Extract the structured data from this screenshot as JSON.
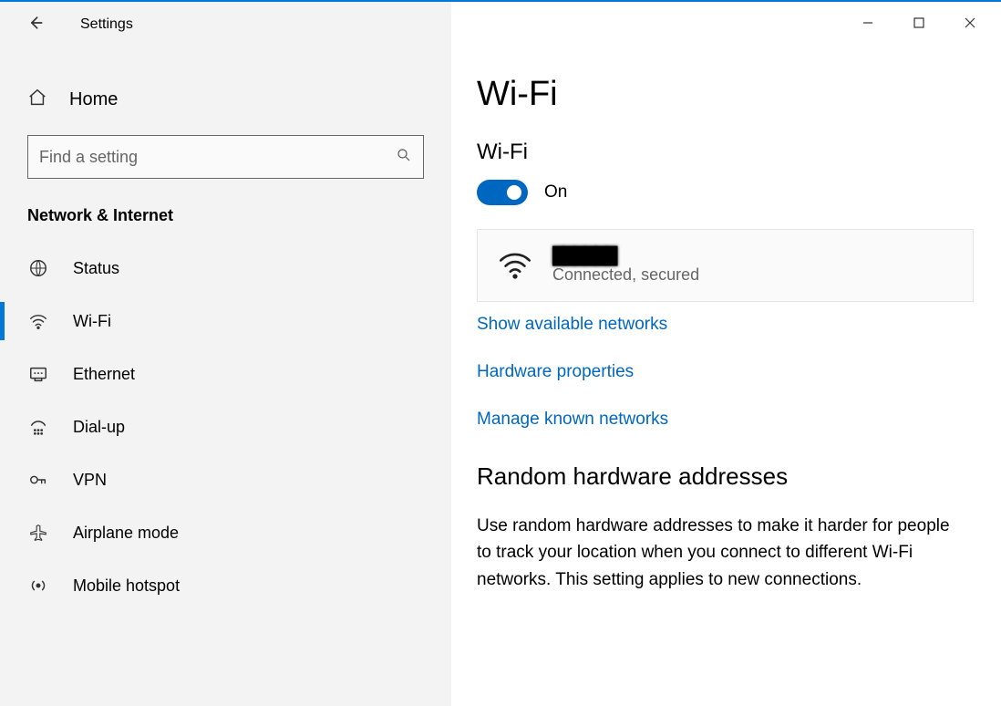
{
  "app_title": "Settings",
  "sidebar": {
    "home_label": "Home",
    "search_placeholder": "Find a setting",
    "category_heading": "Network & Internet",
    "items": [
      {
        "key": "status",
        "label": "Status",
        "active": false
      },
      {
        "key": "wifi",
        "label": "Wi-Fi",
        "active": true
      },
      {
        "key": "ethernet",
        "label": "Ethernet",
        "active": false
      },
      {
        "key": "dialup",
        "label": "Dial-up",
        "active": false
      },
      {
        "key": "vpn",
        "label": "VPN",
        "active": false
      },
      {
        "key": "airplane",
        "label": "Airplane mode",
        "active": false
      },
      {
        "key": "hotspot",
        "label": "Mobile hotspot",
        "active": false
      }
    ]
  },
  "main": {
    "page_title": "Wi-Fi",
    "wifi_section_heading": "Wi-Fi",
    "toggle_state_label": "On",
    "toggle_on": true,
    "connected_network": {
      "name_redacted": "██████",
      "status": "Connected, secured"
    },
    "links": {
      "show_networks": "Show available networks",
      "hardware_props": "Hardware properties",
      "manage_known": "Manage known networks"
    },
    "random_hw_heading": "Random hardware addresses",
    "random_hw_body": "Use random hardware addresses to make it harder for people to track your location when you connect to different Wi-Fi networks. This setting applies to new connections."
  },
  "colors": {
    "accent": "#0078d7",
    "link": "#0067c0"
  }
}
